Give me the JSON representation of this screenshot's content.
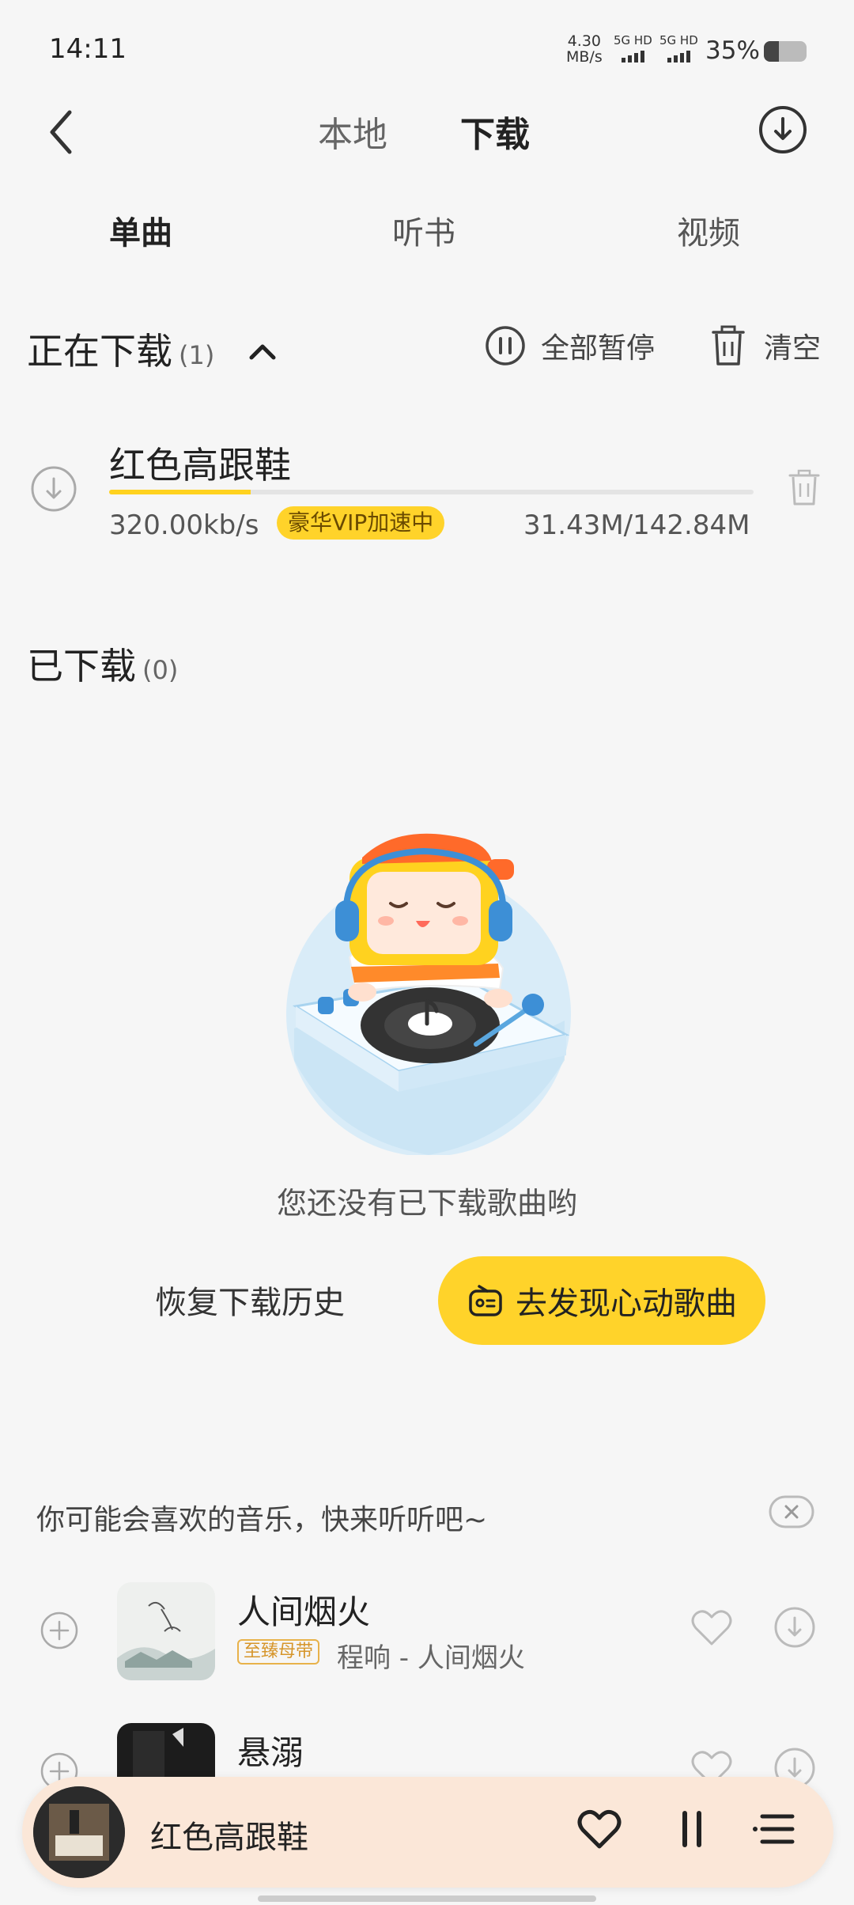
{
  "status_bar": {
    "time": "14:11",
    "net_speed_value": "4.30",
    "net_speed_unit": "MB/s",
    "sim1": "5G HD",
    "sim2": "5G HD",
    "battery_text": "35%",
    "battery_level": 0.35
  },
  "top_nav": {
    "tab_local": "本地",
    "tab_download": "下载"
  },
  "sub_tabs": {
    "singles": "单曲",
    "audiobooks": "听书",
    "videos": "视频"
  },
  "downloading": {
    "title": "正在下载",
    "count": "(1)",
    "pause_all": "全部暂停",
    "clear": "清空",
    "items": [
      {
        "title": "红色高跟鞋",
        "speed": "320.00kb/s",
        "badge": "豪华VIP加速中",
        "size": "31.43M/142.84M",
        "progress": 0.22
      }
    ]
  },
  "downloaded": {
    "title": "已下载",
    "count": "(0)",
    "empty_message": "您还没有已下载歌曲哟",
    "restore_history": "恢复下载历史",
    "discover_button": "去发现心动歌曲"
  },
  "recommendations": {
    "title": "你可能会喜欢的音乐，快来听听吧~",
    "songs": [
      {
        "name": "人间烟火",
        "tag": "至臻母带",
        "meta": "程响 - 人间烟火"
      },
      {
        "name": "悬溺",
        "tag": "",
        "meta": ""
      }
    ]
  },
  "player": {
    "title": "红色高跟鞋"
  },
  "colors": {
    "accent": "#ffd32a",
    "background": "#f6f6f6",
    "player_bg": "#fbe7d8"
  }
}
